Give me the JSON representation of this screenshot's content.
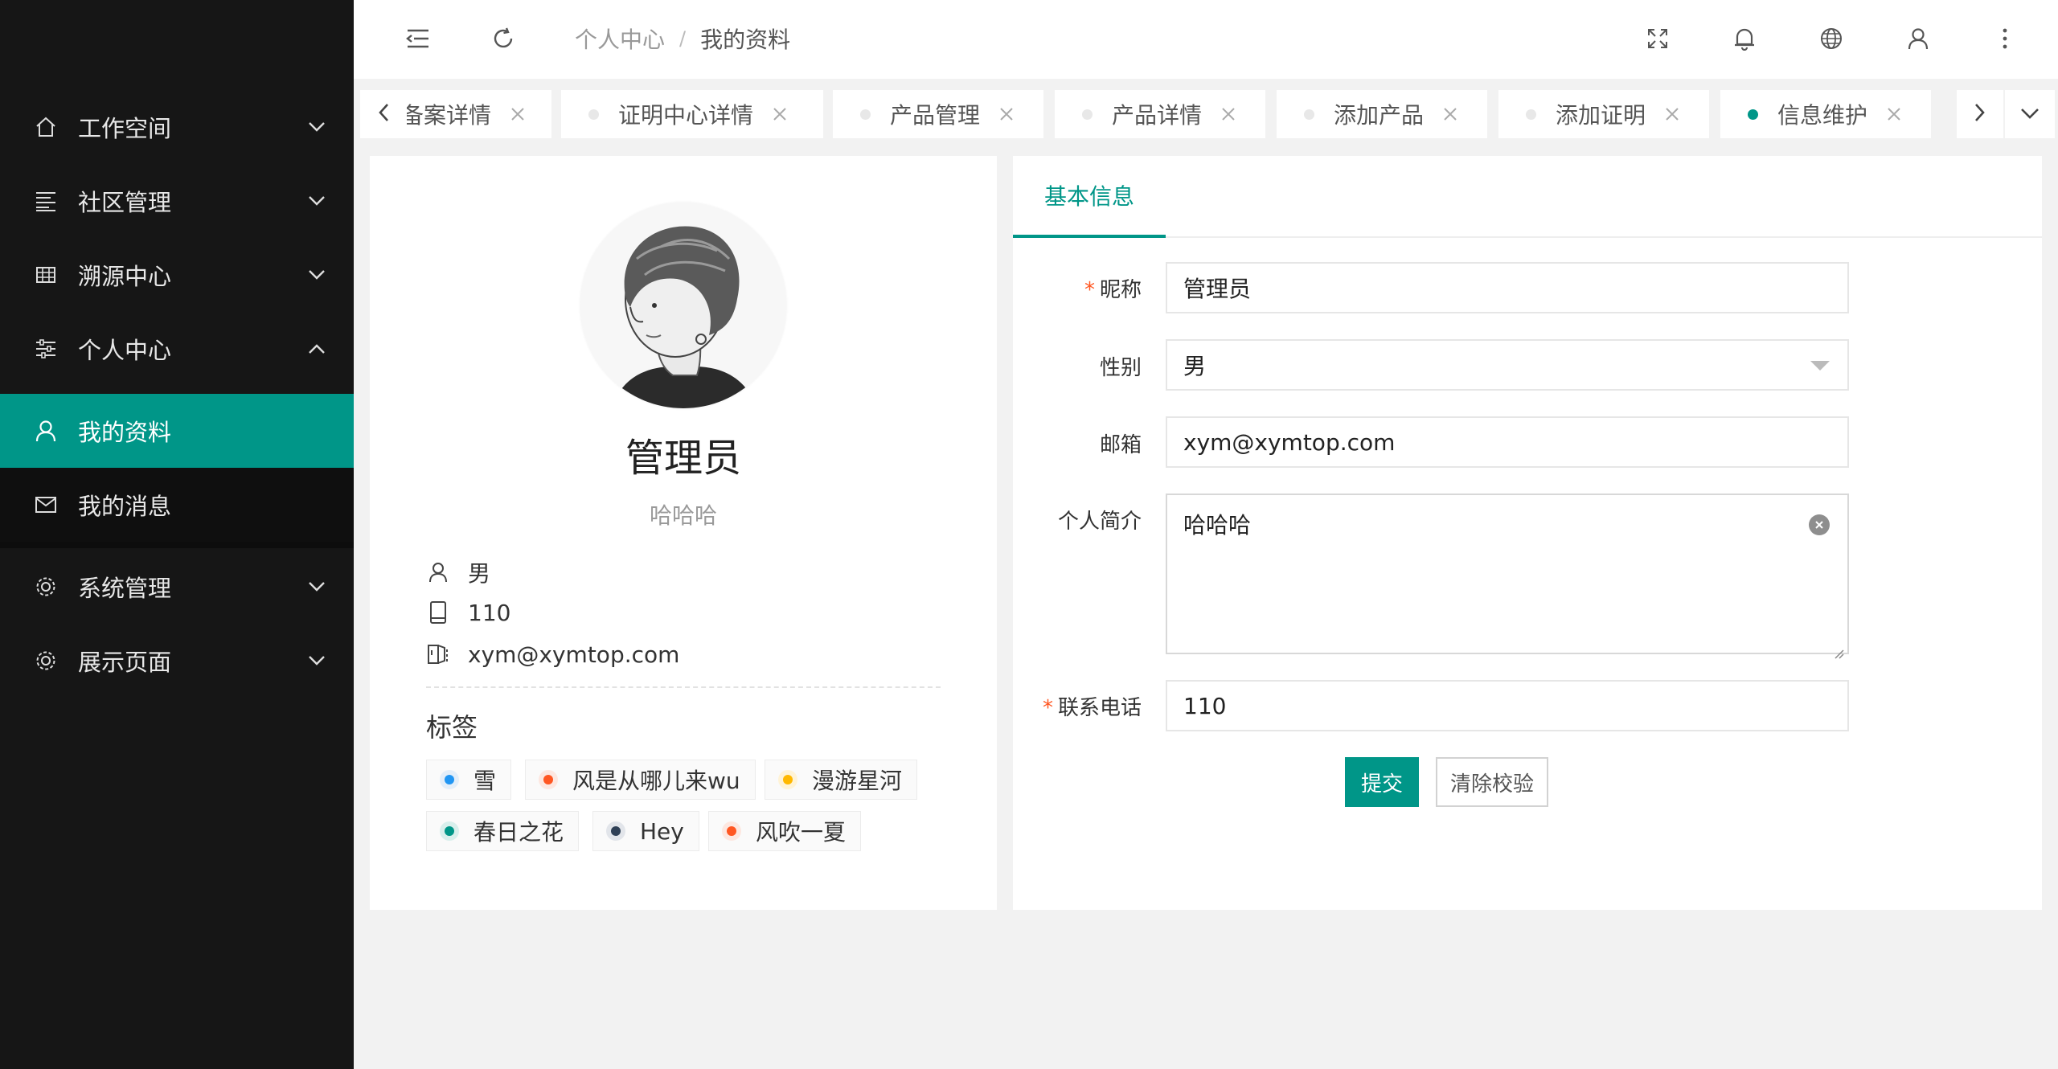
{
  "sidebar": {
    "items": [
      {
        "label": "工作空间",
        "icon": "home-icon"
      },
      {
        "label": "社区管理",
        "icon": "list-icon"
      },
      {
        "label": "溯源中心",
        "icon": "grid-icon"
      },
      {
        "label": "个人中心",
        "icon": "sliders-icon"
      },
      {
        "label": "我的资料",
        "icon": "user-icon"
      },
      {
        "label": "我的消息",
        "icon": "mail-icon"
      },
      {
        "label": "系统管理",
        "icon": "gear-icon"
      },
      {
        "label": "展示页面",
        "icon": "gear-icon"
      }
    ]
  },
  "header": {
    "breadcrumb": [
      "个人中心",
      "我的资料"
    ],
    "separator": "/"
  },
  "tabs": [
    {
      "label": "备案详情",
      "active": false
    },
    {
      "label": "证明中心详情",
      "active": false
    },
    {
      "label": "产品管理",
      "active": false
    },
    {
      "label": "产品详情",
      "active": false
    },
    {
      "label": "添加产品",
      "active": false
    },
    {
      "label": "添加证明",
      "active": false
    },
    {
      "label": "信息维护",
      "active": true
    }
  ],
  "profile": {
    "name": "管理员",
    "bio": "哈哈哈",
    "gender": "男",
    "phone": "110",
    "email": "xym@xymtop.com",
    "tags_title": "标签",
    "tags": [
      {
        "label": "雪",
        "color": "#2196f3"
      },
      {
        "label": "风是从哪儿来wu",
        "color": "#ff5722"
      },
      {
        "label": "漫游星河",
        "color": "#ffb800"
      },
      {
        "label": "春日之花",
        "color": "#009688"
      },
      {
        "label": "Hey",
        "color": "#2f4056"
      },
      {
        "label": "风吹一夏",
        "color": "#ff5722"
      }
    ]
  },
  "form": {
    "tab_label": "基本信息",
    "required_mark": "*",
    "nickname_label": "昵称",
    "nickname_value": "管理员",
    "gender_label": "性别",
    "gender_value": "男",
    "email_label": "邮箱",
    "email_value": "xym@xymtop.com",
    "bio_label": "个人简介",
    "bio_value": "哈哈哈",
    "phone_label": "联系电话",
    "phone_value": "110",
    "submit_label": "提交",
    "reset_label": "清除校验"
  },
  "colors": {
    "accent": "#009688",
    "sidebar_bg": "#161616",
    "required": "#ff5722"
  }
}
